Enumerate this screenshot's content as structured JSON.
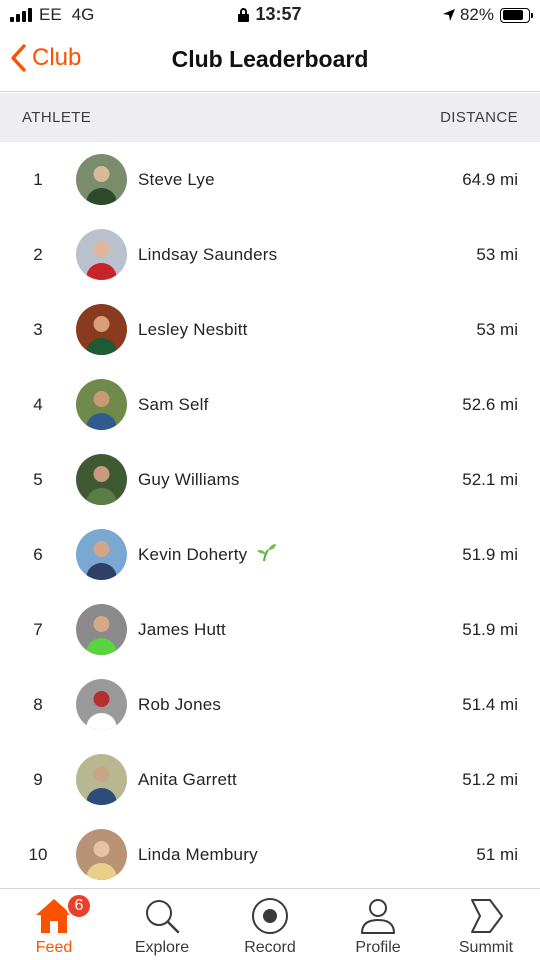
{
  "status_bar": {
    "carrier": "EE",
    "network": "4G",
    "time": "13:57",
    "battery": "82%",
    "battery_level": 0.82
  },
  "nav": {
    "back_label": "Club",
    "title": "Club Leaderboard"
  },
  "columns": {
    "athlete": "ATHLETE",
    "distance": "DISTANCE"
  },
  "athletes": [
    {
      "rank": "1",
      "name": "Steve Lye",
      "distance": "64.9 mi",
      "avatar_colors": [
        "#7a8c6a",
        "#2d4a2b",
        "#d9b99a"
      ]
    },
    {
      "rank": "2",
      "name": "Lindsay Saunders",
      "distance": "53 mi",
      "avatar_colors": [
        "#b9c2cc",
        "#c8252b",
        "#e2b49a"
      ]
    },
    {
      "rank": "3",
      "name": "Lesley Nesbitt",
      "distance": "53 mi",
      "avatar_colors": [
        "#8a3a1e",
        "#1d5a36",
        "#d8a07a"
      ]
    },
    {
      "rank": "4",
      "name": "Sam Self",
      "distance": "52.6 mi",
      "avatar_colors": [
        "#6f8a4a",
        "#2f5b8f",
        "#c89a72"
      ]
    },
    {
      "rank": "5",
      "name": "Guy Williams",
      "distance": "52.1 mi",
      "avatar_colors": [
        "#3f5a33",
        "#5a7d45",
        "#c99a7e"
      ]
    },
    {
      "rank": "6",
      "name": "Kevin Doherty",
      "distance": "51.9 mi",
      "avatar_colors": [
        "#7ba8d2",
        "#2f3f66",
        "#d2a686"
      ],
      "sprout": true
    },
    {
      "rank": "7",
      "name": "James Hutt",
      "distance": "51.9 mi",
      "avatar_colors": [
        "#8a8a8a",
        "#5bd23f",
        "#d4a988"
      ]
    },
    {
      "rank": "8",
      "name": "Rob Jones",
      "distance": "51.4 mi",
      "avatar_colors": [
        "#9a9a9a",
        "#ffffff",
        "#b23030"
      ]
    },
    {
      "rank": "9",
      "name": "Anita Garrett",
      "distance": "51.2 mi",
      "avatar_colors": [
        "#b7b892",
        "#2b4d7a",
        "#caa585"
      ]
    },
    {
      "rank": "10",
      "name": "Linda Membury",
      "distance": "51 mi",
      "avatar_colors": [
        "#b89376",
        "#e8cf8a",
        "#e5c3a8"
      ]
    }
  ],
  "tabs": [
    {
      "label": "Feed",
      "icon": "home-icon",
      "active": true,
      "badge": "6"
    },
    {
      "label": "Explore",
      "icon": "search-icon"
    },
    {
      "label": "Record",
      "icon": "record-icon"
    },
    {
      "label": "Profile",
      "icon": "profile-icon"
    },
    {
      "label": "Summit",
      "icon": "summit-icon"
    }
  ],
  "colors": {
    "accent": "#fc5200",
    "badge": "#e8402d"
  }
}
